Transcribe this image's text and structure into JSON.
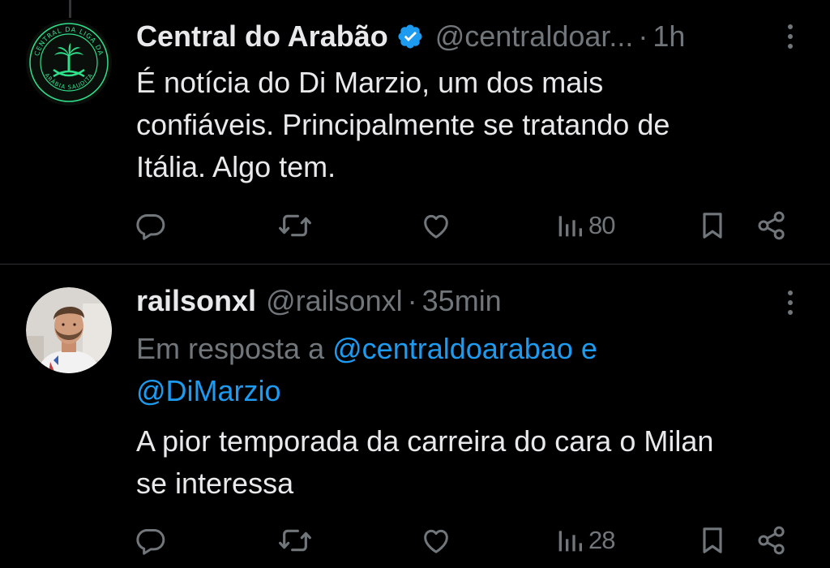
{
  "tweets": [
    {
      "display_name": "Central do Arabão",
      "verified": true,
      "handle": "@centraldoar...",
      "separator": "·",
      "time": "1h",
      "text_lines": [
        "É notícia do Di Marzio, um dos mais",
        "confiáveis. Principalmente se tratando de",
        "Itália. Algo tem."
      ],
      "avatar": {
        "type": "logo",
        "icon": "palm-swords-logo",
        "ring_text_top": "CENTRAL DA LIGA DA",
        "ring_text_bottom": "ARÁBIA SAUDITA",
        "accent": "#2fe08a"
      },
      "actions": {
        "views": "80"
      }
    },
    {
      "display_name": "railsonxl",
      "verified": false,
      "handle": "@railsonxl",
      "separator": "·",
      "time": "35min",
      "reply_to": {
        "prefix": "Em resposta a",
        "mention_1": "@centraldoarabao",
        "conjunction": "e",
        "mention_2": "@DiMarzio"
      },
      "text_lines": [
        "A pior temporada da carreira do cara o Milan",
        "se interessa"
      ],
      "avatar": {
        "type": "photo",
        "icon": "user-photo"
      },
      "actions": {
        "views": "28"
      }
    }
  ],
  "colors": {
    "background": "#000000",
    "text_primary": "#e7e9ea",
    "text_secondary": "#71767b",
    "mention": "#1d9bf0",
    "verified_badge": "#1d9bf0",
    "divider": "#2f3336"
  },
  "icons": {
    "reply": "reply-icon",
    "retweet": "retweet-icon",
    "like": "heart-icon",
    "views": "views-chart-icon",
    "bookmark": "bookmark-icon",
    "share": "share-icon",
    "more": "more-vertical-icon",
    "verified": "verified-badge-icon"
  }
}
